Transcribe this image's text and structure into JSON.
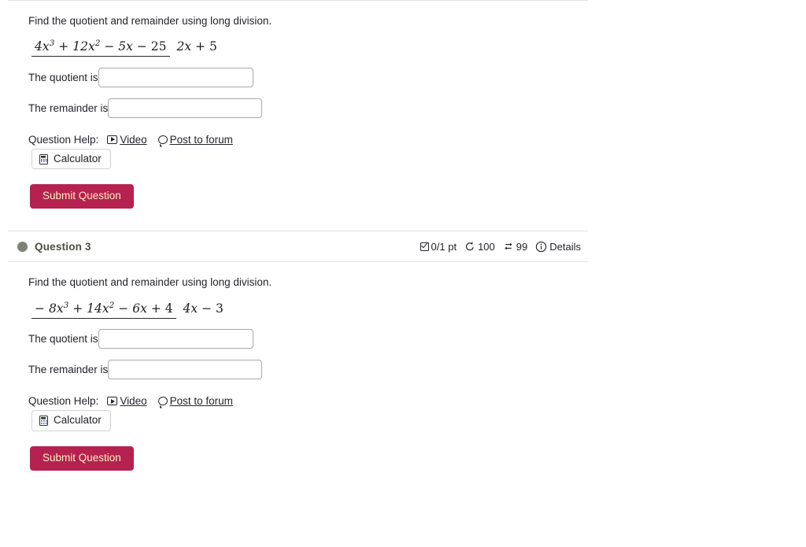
{
  "page": {
    "accent_color": "#b5224f",
    "submit_text_color": "#fbeec3",
    "divider_color": "#e2e2e2"
  },
  "questions": [
    {
      "prompt": "Find the quotient and remainder using long division.",
      "expression": {
        "numerator_plain": "4x^3 + 12x^2 - 5x - 25",
        "denominator_plain": "2x + 5",
        "numerator_parts": {
          "t1_coef": "4",
          "t1_var": "x",
          "t1_exp": "3",
          "op1": "+",
          "t2_coef": "12",
          "t2_var": "x",
          "t2_exp": "2",
          "op2": "−",
          "t3_coef": "5",
          "t3_var": "x",
          "op3": "−",
          "t4": "25",
          "lead_sign": ""
        },
        "denominator_parts": {
          "d1_coef": "2",
          "d1_var": "x",
          "dop": "+",
          "d2": "5"
        }
      },
      "quotient_label": "The quotient is",
      "quotient_value": "",
      "remainder_label": "The remainder is",
      "remainder_value": "",
      "help_label": "Question Help:",
      "video_label": "Video",
      "forum_label": "Post to forum",
      "calculator_label": "Calculator",
      "submit_label": "Submit Question"
    },
    {
      "prompt": "Find the quotient and remainder using long division.",
      "expression": {
        "numerator_plain": "-8x^3 + 14x^2 - 6x + 4",
        "denominator_plain": "4x - 3",
        "numerator_parts": {
          "lead_sign": "−",
          "t1_coef": "8",
          "t1_var": "x",
          "t1_exp": "3",
          "op1": "+",
          "t2_coef": "14",
          "t2_var": "x",
          "t2_exp": "2",
          "op2": "−",
          "t3_coef": "6",
          "t3_var": "x",
          "op3": "+",
          "t4": "4"
        },
        "denominator_parts": {
          "d1_coef": "4",
          "d1_var": "x",
          "dop": "−",
          "d2": "3"
        }
      },
      "quotient_label": "The quotient is",
      "quotient_value": "",
      "remainder_label": "The remainder is",
      "remainder_value": "",
      "help_label": "Question Help:",
      "video_label": "Video",
      "forum_label": "Post to forum",
      "calculator_label": "Calculator",
      "submit_label": "Submit Question"
    }
  ],
  "question_header": {
    "title": "Question 3",
    "score": "0/1 pt",
    "attempts_left": "100",
    "retries": "99",
    "details_label": "Details"
  }
}
